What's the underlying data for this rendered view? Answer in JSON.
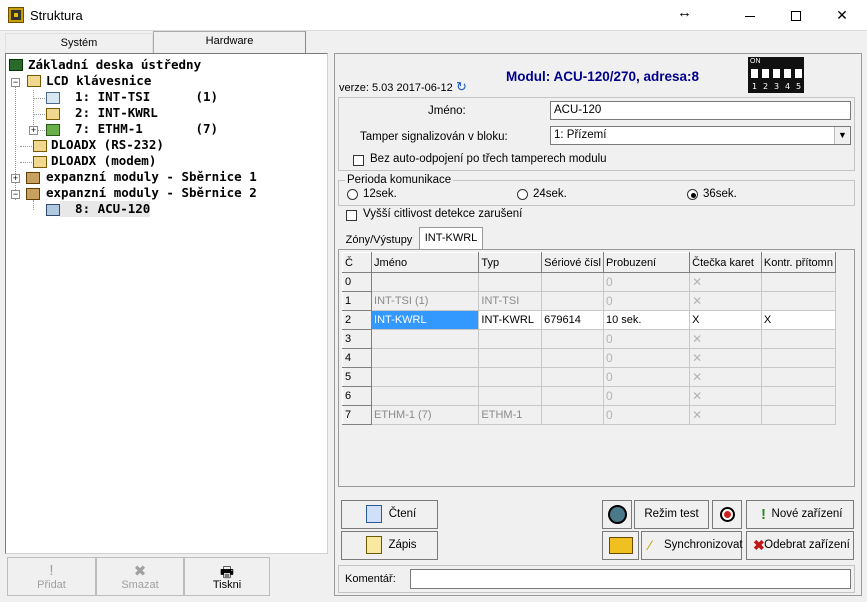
{
  "window": {
    "title": "Struktura",
    "resize_glyph": "↔",
    "close_glyph": "✕"
  },
  "left_tabs": [
    "Systém",
    "Hardware"
  ],
  "tree": {
    "nodes": [
      {
        "label": "Základní deska ústředny"
      },
      {
        "label": "LCD klávesnice"
      },
      {
        "label": "  1: INT-TSI      (1)"
      },
      {
        "label": "  2: INT-KWRL"
      },
      {
        "label": "  7: ETHM-1       (7)"
      },
      {
        "label": "DLOADX (RS-232)"
      },
      {
        "label": "DLOADX (modem)"
      },
      {
        "label": "expanzní moduly - Sběrnice 1"
      },
      {
        "label": "expanzní moduly - Sběrnice 2"
      },
      {
        "label": "  8: ACU-120"
      }
    ],
    "expanders": [
      "−",
      "+",
      "+",
      "−"
    ]
  },
  "left_buttons": [
    {
      "label": "Přidat",
      "icon": "!"
    },
    {
      "label": "Smazat",
      "icon": "✖"
    },
    {
      "label": "Tiskni",
      "icon": "🖶"
    }
  ],
  "module": {
    "title": "Modul: ACU-120/270, adresa:8",
    "version": "verze: 5.03 2017-06-12",
    "version_icon": "↻",
    "dip": {
      "on_label": "ON",
      "numbers": [
        "1",
        "2",
        "3",
        "4",
        "5"
      ]
    }
  },
  "form": {
    "name_label": "Jméno:",
    "name_value": "ACU-120",
    "tamper_label": "Tamper signalizován v bloku:",
    "tamper_value": "1: Přízemí",
    "auto_disconnect_label": "Bez auto-odpojení po třech tamperech modulu",
    "period_label": "Perioda komunikace",
    "period_options": [
      "12sek.",
      "24sek.",
      "36sek."
    ],
    "higher_sensitivity_label": "Vyšší citlivost detekce zarušení"
  },
  "inner_tabs": [
    "Zóny/Výstupy",
    "INT-KWRL"
  ],
  "grid": {
    "headers": [
      "Č",
      "Jméno",
      "Typ",
      "Sériové čísl",
      "Probuzení",
      "Čtečka karet",
      "Kontr. přítomn"
    ],
    "rows": [
      {
        "n": "0",
        "name": "",
        "type": "",
        "serial": "",
        "wake": "0",
        "reader": "✕",
        "presence": ""
      },
      {
        "n": "1",
        "name": "INT-TSI     (1)",
        "type": "INT-TSI",
        "serial": "",
        "wake": "0",
        "reader": "✕",
        "presence": ""
      },
      {
        "n": "2",
        "name": "INT-KWRL",
        "type": "INT-KWRL",
        "serial": "679614",
        "wake": "10 sek.",
        "reader": "X",
        "presence": "X"
      },
      {
        "n": "3",
        "name": "",
        "type": "",
        "serial": "",
        "wake": "0",
        "reader": "✕",
        "presence": ""
      },
      {
        "n": "4",
        "name": "",
        "type": "",
        "serial": "",
        "wake": "0",
        "reader": "✕",
        "presence": ""
      },
      {
        "n": "5",
        "name": "",
        "type": "",
        "serial": "",
        "wake": "0",
        "reader": "✕",
        "presence": ""
      },
      {
        "n": "6",
        "name": "",
        "type": "",
        "serial": "",
        "wake": "0",
        "reader": "✕",
        "presence": ""
      },
      {
        "n": "7",
        "name": "ETHM-1     (7)",
        "type": "ETHM-1",
        "serial": "",
        "wake": "0",
        "reader": "✕",
        "presence": ""
      }
    ]
  },
  "buttons": {
    "read": "Čtení",
    "write": "Zápis",
    "test_mode": "Režim test",
    "new_device": "Nové zařízení",
    "sync": "Synchronizovat",
    "remove_device": "Odebrat zařízení",
    "new_icon": "!",
    "remove_icon": "✖"
  },
  "comment_label": "Komentář:",
  "colors": {
    "module_title": "#00008c",
    "selection": "#3399ff"
  }
}
